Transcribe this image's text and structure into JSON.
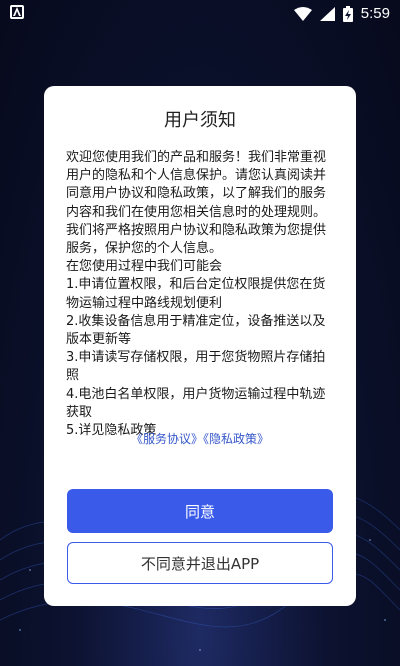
{
  "status_bar": {
    "time": "5:59",
    "icons": [
      "notification-a-icon",
      "wifi-icon",
      "signal-icon",
      "battery-charging-icon"
    ]
  },
  "dialog": {
    "title": "用户须知",
    "paragraphs": [
      "欢迎您使用我们的产品和服务！我们非常重视用户的隐私和个人信息保护。请您认真阅读并同意用户协议和隐私政策，以了解我们的服务内容和我们在使用您相关信息时的处理规则。我们将严格按照用户协议和隐私政策为您提供服务，保护您的个人信息。",
      "在您使用过程中我们可能会",
      " 1.申请位置权限，和后台定位权限提供您在货物运输过程中路线规划便利",
      " 2.收集设备信息用于精准定位，设备推送以及版本更新等",
      " 3.申请读写存储权限，用于您货物照片存储拍照",
      " 4.电池白名单权限，用户货物运输过程中轨迹获取",
      " 5.详见隐私政策"
    ],
    "links": {
      "service_agreement": "《服务协议》",
      "privacy_policy": "《隐私政策》"
    },
    "agree_button": "同意",
    "disagree_button": "不同意并退出APP"
  },
  "colors": {
    "primary": "#3a5bea",
    "link": "#3557c9",
    "background_dark": "#0c1230"
  }
}
